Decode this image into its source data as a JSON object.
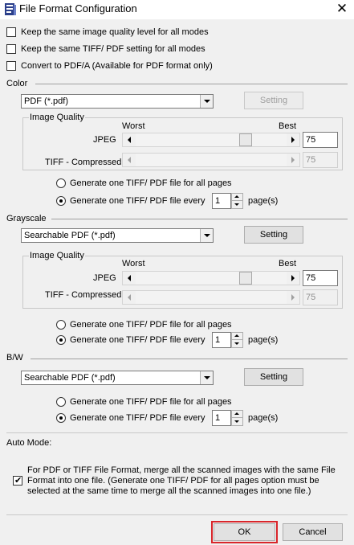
{
  "window": {
    "title": "File Format Configuration",
    "close_glyph": "✕"
  },
  "options": [
    {
      "label": "Keep the same image quality level for all modes",
      "checked": false
    },
    {
      "label": "Keep the same TIFF/ PDF setting for all modes",
      "checked": false
    },
    {
      "label": "Convert to PDF/A (Available for PDF format only)",
      "checked": false
    }
  ],
  "color": {
    "title": "Color",
    "format": "PDF (*.pdf)",
    "setting_label": "Setting",
    "setting_enabled": false,
    "image_quality": {
      "title": "Image Quality",
      "worst": "Worst",
      "best": "Best",
      "jpeg_label": "JPEG",
      "jpeg_value": "75",
      "jpeg_level": 0.75,
      "tiff_label": "TIFF - Compressed",
      "tiff_value": "75"
    },
    "radio_all": "Generate one TIFF/ PDF file for all pages",
    "radio_every": "Generate one TIFF/ PDF file every",
    "selected": "every",
    "pages": "1",
    "pages_unit": "page(s)"
  },
  "grayscale": {
    "title": "Grayscale",
    "format": "Searchable PDF (*.pdf)",
    "setting_label": "Setting",
    "setting_enabled": true,
    "image_quality": {
      "title": "Image Quality",
      "worst": "Worst",
      "best": "Best",
      "jpeg_label": "JPEG",
      "jpeg_value": "75",
      "jpeg_level": 0.75,
      "tiff_label": "TIFF - Compressed",
      "tiff_value": "75"
    },
    "radio_all": "Generate one TIFF/ PDF file for all pages",
    "radio_every": "Generate one TIFF/ PDF file every",
    "selected": "every",
    "pages": "1",
    "pages_unit": "page(s)"
  },
  "bw": {
    "title": "B/W",
    "format": "Searchable PDF (*.pdf)",
    "setting_label": "Setting",
    "setting_enabled": true,
    "radio_all": "Generate one TIFF/ PDF file for all pages",
    "radio_every": "Generate one TIFF/ PDF file every",
    "selected": "every",
    "pages": "1",
    "pages_unit": "page(s)"
  },
  "auto_mode": {
    "title": "Auto Mode:",
    "checked": true,
    "text_line1": "For PDF or TIFF File Format, merge all the scanned images with the same File",
    "text_line2": "Format into one file. (Generate one TIFF/ PDF for all pages option must be",
    "text_line3": "selected at the same time to merge all the scanned images into one file.)"
  },
  "buttons": {
    "ok": "OK",
    "cancel": "Cancel"
  },
  "colors": {
    "highlight": "#d9262b",
    "dialog_bg": "#f0f0f0"
  }
}
